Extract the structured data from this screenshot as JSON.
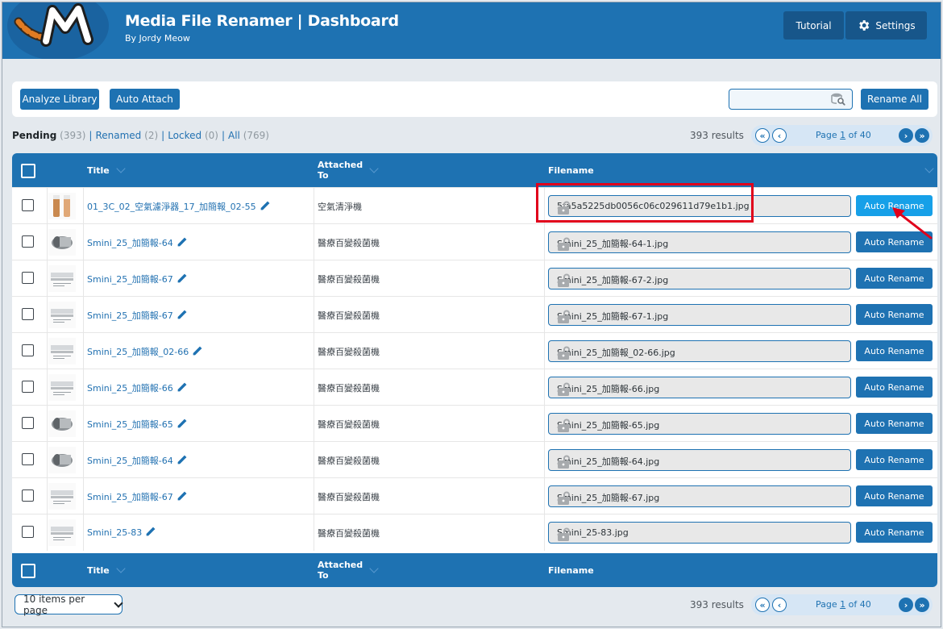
{
  "header": {
    "app_title": "Media File Renamer | Dashboard",
    "subtitle": "By Jordy Meow",
    "tutorial_label": "Tutorial",
    "settings_label": "Settings",
    "accent_color": "#1e72b2"
  },
  "toolbar": {
    "analyze_label": "Analyze Library",
    "auto_attach_label": "Auto Attach",
    "search_placeholder": "",
    "rename_all_label": "Rename All"
  },
  "filters": {
    "pending_label": "Pending",
    "pending_count": "(393)",
    "renamed_label": "Renamed",
    "renamed_count": "(2)",
    "locked_label": "Locked",
    "locked_count": "(0)",
    "all_label": "All",
    "all_count": "(769)",
    "separator": "|"
  },
  "pagination": {
    "results_text": "393 results",
    "page_prefix": "Page ",
    "page_current": "1",
    "page_suffix": " of 40"
  },
  "table": {
    "col_title": "Title",
    "col_attached_line1": "Attached",
    "col_attached_line2": "To",
    "col_filename": "Filename",
    "action_label": "Auto Rename",
    "rows": [
      {
        "title": "01_3C_02_空氣濾淨器_17_加簡報_02-55",
        "attached": "空氣清淨機",
        "filename": "5fa5a5225db0056c06c029611d79e1b1.jpg"
      },
      {
        "title": "Smini_25_加簡報-64",
        "attached": "醫療百變殺菌機",
        "filename": "Smini_25_加簡報-64-1.jpg"
      },
      {
        "title": "Smini_25_加簡報-67",
        "attached": "醫療百變殺菌機",
        "filename": "Smini_25_加簡報-67-2.jpg"
      },
      {
        "title": "Smini_25_加簡報-67",
        "attached": "醫療百變殺菌機",
        "filename": "Smini_25_加簡報-67-1.jpg"
      },
      {
        "title": "Smini_25_加簡報_02-66",
        "attached": "醫療百變殺菌機",
        "filename": "Smini_25_加簡報_02-66.jpg"
      },
      {
        "title": "Smini_25_加簡報-66",
        "attached": "醫療百變殺菌機",
        "filename": "Smini_25_加簡報-66.jpg"
      },
      {
        "title": "Smini_25_加簡報-65",
        "attached": "醫療百變殺菌機",
        "filename": "Smini_25_加簡報-65.jpg"
      },
      {
        "title": "Smini_25_加簡報-64",
        "attached": "醫療百變殺菌機",
        "filename": "Smini_25_加簡報-64.jpg"
      },
      {
        "title": "Smini_25_加簡報-67",
        "attached": "醫療百變殺菌機",
        "filename": "Smini_25_加簡報-67.jpg"
      },
      {
        "title": "Smini_25-83",
        "attached": "醫療百變殺菌機",
        "filename": "Smini_25-83.jpg"
      }
    ]
  },
  "footer": {
    "per_page_label": "10 items per page"
  }
}
